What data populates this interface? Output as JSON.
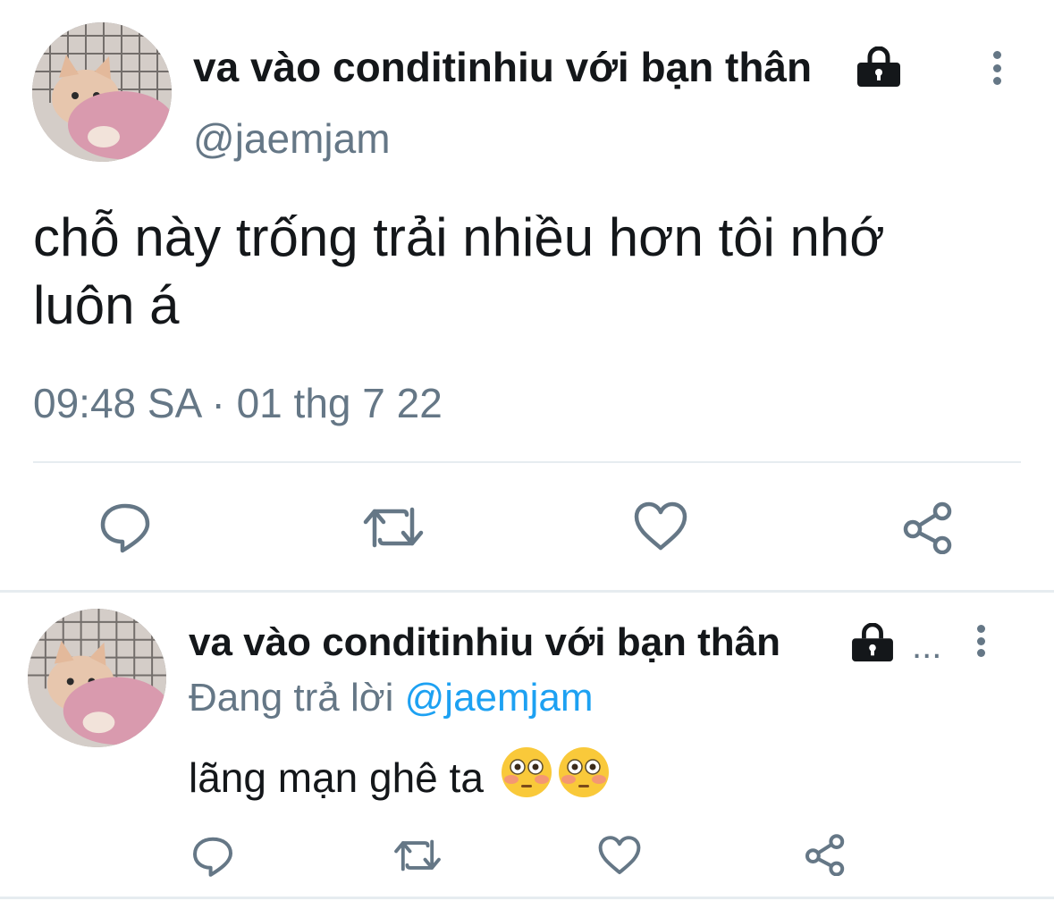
{
  "main_tweet": {
    "display_name": "va vào conditinhiu với bạn thân",
    "handle": "@jaemjam",
    "text_line1": "chỗ này trống trải nhiều hơn tôi nhớ",
    "text_line2": "luôn á",
    "timestamp": "09:48 SA · 01 thg 7 22",
    "actions": [
      "reply-icon",
      "retweet-icon",
      "like-icon",
      "share-icon"
    ]
  },
  "reply_tweet": {
    "display_name": "va vào conditinhiu với bạn thân",
    "ellipsis": "...",
    "replying_prefix": "Đang trả lời",
    "replying_to": "@jaemjam",
    "text": "lãng mạn ghê ta",
    "emojis": [
      "flushed-face",
      "flushed-face"
    ],
    "actions": [
      "reply-icon",
      "retweet-icon",
      "like-icon",
      "share-icon"
    ]
  },
  "colors": {
    "text": "#14171a",
    "secondary": "#657786",
    "accent": "#1da1f2",
    "divider": "#e6ecf0"
  }
}
